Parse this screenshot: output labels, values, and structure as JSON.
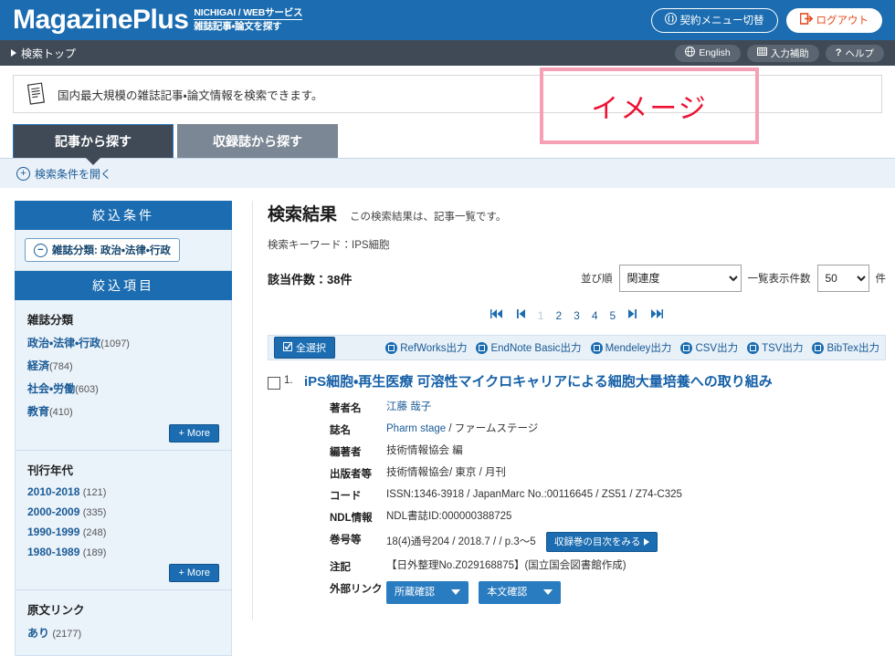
{
  "header": {
    "logo_main": "MagazinePlus",
    "logo_sub_top": "NICHIGAI / WEBサービス",
    "logo_sub_bottom": "雑誌記事・論文を探す",
    "contract_button": "契約メニュー切替",
    "logout_button": "ログアウト"
  },
  "navbar": {
    "breadcrumb": "検索トップ",
    "english_button": "English",
    "input_assist_button": "入力補助",
    "help_button": "ヘルプ"
  },
  "infobar": {
    "text": "国内最大規模の雑誌記事・論文情報を検索できます。"
  },
  "annotation": {
    "image_label": "イメージ",
    "border_color": "#f5a0b5",
    "text_color": "#ee1133"
  },
  "tabs": [
    {
      "label": "記事から探す",
      "active": true
    },
    {
      "label": "収録誌から探す",
      "active": false
    }
  ],
  "search_condition": {
    "open_label": "検索条件を開く"
  },
  "sidebar": {
    "filter_panel_title": "絞込条件",
    "active_filter_chip": "雑誌分類: 政治・法律・行政",
    "facet_panel_title": "絞込項目",
    "more_label": "+ More",
    "facets": [
      {
        "title": "雑誌分類",
        "items": [
          {
            "label": "政治・法律・行政",
            "count": "(1097)"
          },
          {
            "label": "経済",
            "count": "(784)"
          },
          {
            "label": "社会・労働",
            "count": "(603)"
          },
          {
            "label": "教育",
            "count": "(410)"
          }
        ],
        "has_more": true
      },
      {
        "title": "刊行年代",
        "items": [
          {
            "label": "2010-2018",
            "count": "(121)"
          },
          {
            "label": "2000-2009",
            "count": "(335)"
          },
          {
            "label": "1990-1999",
            "count": "(248)"
          },
          {
            "label": "1980-1989",
            "count": "(189)"
          }
        ],
        "has_more": true
      },
      {
        "title": "原文リンク",
        "items": [
          {
            "label": "あり",
            "count": "(2177)"
          }
        ],
        "has_more": false
      }
    ]
  },
  "results": {
    "title": "検索結果",
    "subtitle": "この検索結果は、記事一覧です。",
    "keyword_line": "検索キーワード：IPS細胞",
    "count_line": "該当件数：38件",
    "sort_label": "並び順",
    "sort_value": "関連度",
    "sort_options": [
      "関連度"
    ],
    "per_page_label": "一覧表示件数",
    "per_page_value": "50",
    "per_page_options": [
      "50"
    ],
    "per_page_unit": "件",
    "pagination": {
      "first": "⏮",
      "prev": "◀|",
      "pages": [
        "1",
        "2",
        "3",
        "4",
        "5"
      ],
      "current_page": "1",
      "next": "|▶",
      "last": "⏭"
    },
    "toolbar": {
      "select_all": "全選択",
      "exports": [
        "RefWorks出力",
        "EndNote Basic出力",
        "Mendeley出力",
        "CSV出力",
        "TSV出力",
        "BibTex出力"
      ]
    },
    "items": [
      {
        "number": "1.",
        "title": "iPS細胞・再生医療 可溶性マイクロキャリアによる細胞大量培養への取り組み",
        "meta": [
          {
            "key": "著者名",
            "value": "江藤 哉子",
            "link": true
          },
          {
            "key": "誌名",
            "value": "Pharm stage",
            "value2": " / ファームステージ",
            "link": true
          },
          {
            "key": "編著者",
            "value": "技術情報協会 編",
            "link": false
          },
          {
            "key": "出版者等",
            "value": "技術情報協会/ 東京 / 月刊",
            "link": false
          },
          {
            "key": "コード",
            "value": "ISSN:1346-3918 / JapanMarc No.:00116645 / ZS51 / Z74-C325",
            "link": false
          },
          {
            "key": "NDL情報",
            "value": "NDL書誌ID:000000388725",
            "link": false
          },
          {
            "key": "巻号等",
            "value": "18(4)通号204 / 2018.7 /  / p.3〜5",
            "link": false,
            "button": "収録巻の目次をみる"
          },
          {
            "key": "注記",
            "value": "【日外整理No.Z029168875】(国立国会図書館作成)",
            "link": false
          },
          {
            "key": "外部リンク",
            "value": "",
            "link": false,
            "dropdowns": [
              "所蔵確認",
              "本文確認"
            ]
          }
        ]
      }
    ]
  }
}
